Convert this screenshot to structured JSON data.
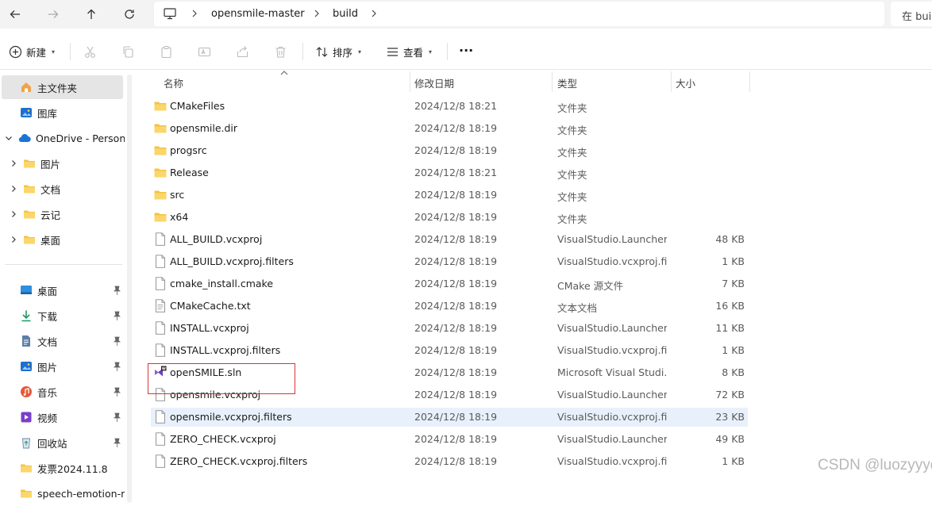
{
  "nav": {
    "back_icon": "arrow-left-icon",
    "forward_icon": "arrow-right-icon",
    "up_icon": "arrow-up-icon",
    "refresh_icon": "refresh-icon"
  },
  "address": {
    "root_icon": "computer-icon",
    "crumbs": [
      "opensmile-master",
      "build"
    ],
    "search_placeholder": "在 bui"
  },
  "toolbar": {
    "new_label": "新建",
    "sort_label": "排序",
    "view_label": "查看",
    "more_label": "···"
  },
  "sidebar": {
    "top": [
      {
        "label": "主文件夹",
        "icon": "home-icon"
      },
      {
        "label": "图库",
        "icon": "gallery-icon"
      },
      {
        "label": "OneDrive - Person",
        "icon": "cloud-icon"
      },
      {
        "label": "图片",
        "icon": "folder-icon"
      },
      {
        "label": "文档",
        "icon": "folder-icon"
      },
      {
        "label": "云记",
        "icon": "folder-icon"
      },
      {
        "label": "桌面",
        "icon": "folder-icon"
      }
    ],
    "pinned": [
      {
        "label": "桌面",
        "icon": "desktop-icon"
      },
      {
        "label": "下载",
        "icon": "download-icon"
      },
      {
        "label": "文档",
        "icon": "document-icon"
      },
      {
        "label": "图片",
        "icon": "picture-icon"
      },
      {
        "label": "音乐",
        "icon": "music-icon"
      },
      {
        "label": "视频",
        "icon": "video-icon"
      },
      {
        "label": "回收站",
        "icon": "recycle-bin-icon"
      },
      {
        "label": "发票2024.11.8",
        "icon": "folder-icon"
      },
      {
        "label": "speech-emotion-re",
        "icon": "folder-icon"
      }
    ]
  },
  "columns": {
    "name": "名称",
    "date": "修改日期",
    "type": "类型",
    "size": "大小"
  },
  "files": [
    {
      "name": "CMakeFiles",
      "date": "2024/12/8 18:21",
      "type": "文件夹",
      "size": "",
      "icon": "folder-icon"
    },
    {
      "name": "opensmile.dir",
      "date": "2024/12/8 18:19",
      "type": "文件夹",
      "size": "",
      "icon": "folder-icon"
    },
    {
      "name": "progsrc",
      "date": "2024/12/8 18:19",
      "type": "文件夹",
      "size": "",
      "icon": "folder-icon"
    },
    {
      "name": "Release",
      "date": "2024/12/8 18:21",
      "type": "文件夹",
      "size": "",
      "icon": "folder-icon"
    },
    {
      "name": "src",
      "date": "2024/12/8 18:19",
      "type": "文件夹",
      "size": "",
      "icon": "folder-icon"
    },
    {
      "name": "x64",
      "date": "2024/12/8 18:19",
      "type": "文件夹",
      "size": "",
      "icon": "folder-icon"
    },
    {
      "name": "ALL_BUILD.vcxproj",
      "date": "2024/12/8 18:19",
      "type": "VisualStudio.Launcher...",
      "size": "48 KB",
      "icon": "file-icon"
    },
    {
      "name": "ALL_BUILD.vcxproj.filters",
      "date": "2024/12/8 18:19",
      "type": "VisualStudio.vcxproj.fi...",
      "size": "1 KB",
      "icon": "file-icon"
    },
    {
      "name": "cmake_install.cmake",
      "date": "2024/12/8 18:19",
      "type": "CMake 源文件",
      "size": "7 KB",
      "icon": "file-icon"
    },
    {
      "name": "CMakeCache.txt",
      "date": "2024/12/8 18:19",
      "type": "文本文档",
      "size": "16 KB",
      "icon": "text-file-icon"
    },
    {
      "name": "INSTALL.vcxproj",
      "date": "2024/12/8 18:19",
      "type": "VisualStudio.Launcher...",
      "size": "11 KB",
      "icon": "file-icon"
    },
    {
      "name": "INSTALL.vcxproj.filters",
      "date": "2024/12/8 18:19",
      "type": "VisualStudio.vcxproj.fi...",
      "size": "1 KB",
      "icon": "file-icon"
    },
    {
      "name": "openSMILE.sln",
      "date": "2024/12/8 18:19",
      "type": "Microsoft Visual Studi...",
      "size": "8 KB",
      "icon": "visual-studio-solution-icon"
    },
    {
      "name": "opensmile.vcxproj",
      "date": "2024/12/8 18:19",
      "type": "VisualStudio.Launcher...",
      "size": "72 KB",
      "icon": "file-icon"
    },
    {
      "name": "opensmile.vcxproj.filters",
      "date": "2024/12/8 18:19",
      "type": "VisualStudio.vcxproj.fi...",
      "size": "23 KB",
      "icon": "file-icon",
      "selected": true
    },
    {
      "name": "ZERO_CHECK.vcxproj",
      "date": "2024/12/8 18:19",
      "type": "VisualStudio.Launcher...",
      "size": "49 KB",
      "icon": "file-icon"
    },
    {
      "name": "ZERO_CHECK.vcxproj.filters",
      "date": "2024/12/8 18:19",
      "type": "VisualStudio.vcxproj.fi...",
      "size": "1 KB",
      "icon": "file-icon"
    }
  ],
  "watermark": "CSDN @luozyyyds",
  "colors": {
    "folder": "#f6c344",
    "selection": "#e8f1fb",
    "highlight_box": "#d9343a",
    "onedrive": "#1a73d9"
  }
}
